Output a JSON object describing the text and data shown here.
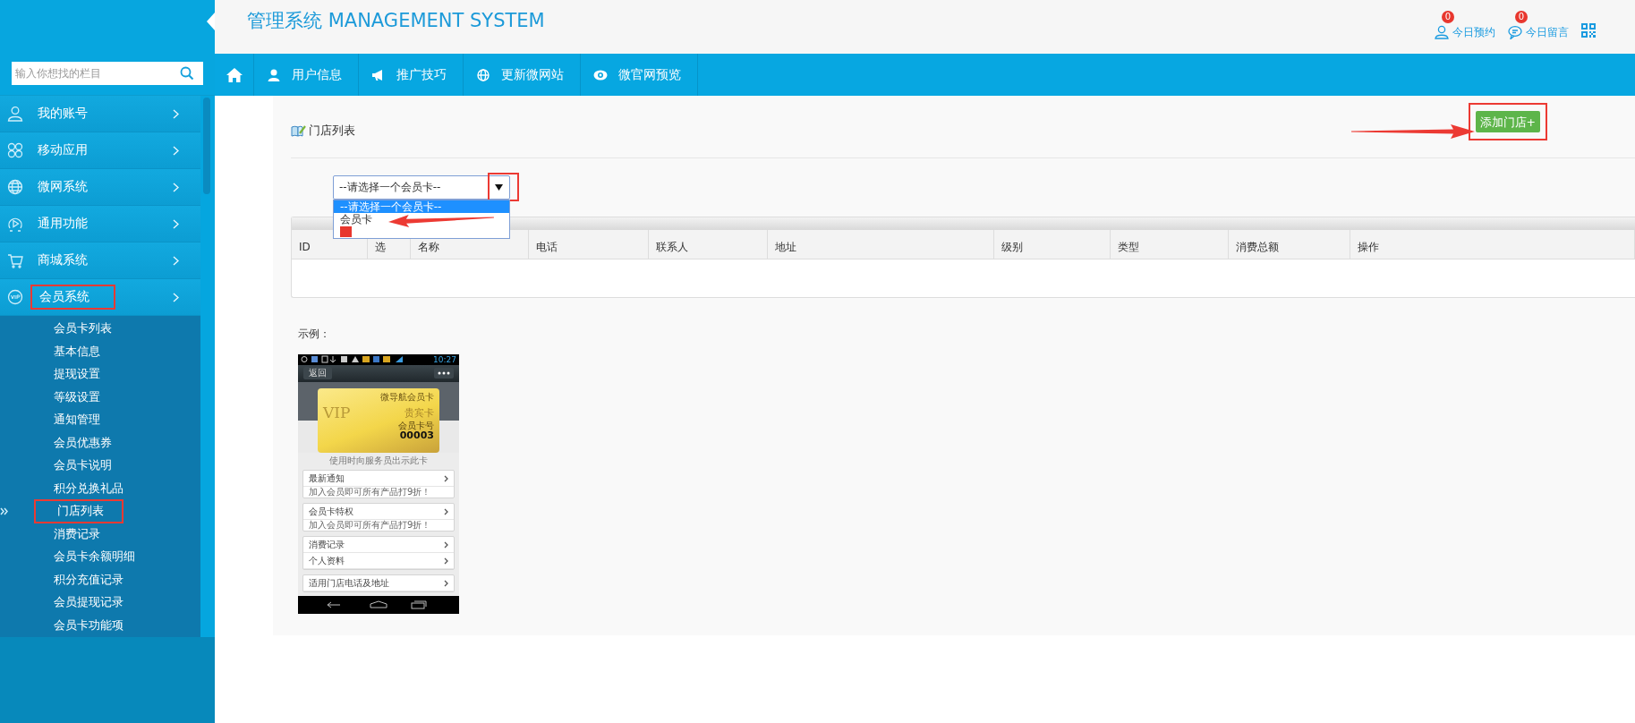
{
  "header": {
    "title": "管理系统 MANAGEMENT SYSTEM",
    "notices": [
      {
        "count": "0",
        "label": "今日预约"
      },
      {
        "count": "0",
        "label": "今日留言"
      }
    ]
  },
  "sidebar": {
    "search": {
      "placeholder": "输入你想找的栏目"
    },
    "items": [
      {
        "label": "我的账号",
        "annotated": false
      },
      {
        "label": "移动应用",
        "annotated": false
      },
      {
        "label": "微网系统",
        "annotated": false
      },
      {
        "label": "通用功能",
        "annotated": false
      },
      {
        "label": "商城系统",
        "annotated": false
      },
      {
        "label": "会员系统",
        "annotated": true,
        "children": [
          {
            "label": "会员卡列表",
            "selected": false
          },
          {
            "label": "基本信息",
            "selected": false
          },
          {
            "label": "提现设置",
            "selected": false
          },
          {
            "label": "等级设置",
            "selected": false
          },
          {
            "label": "通知管理",
            "selected": false
          },
          {
            "label": "会员优惠券",
            "selected": false
          },
          {
            "label": "会员卡说明",
            "selected": false
          },
          {
            "label": "积分兑换礼品",
            "selected": false
          },
          {
            "label": "门店列表",
            "selected": true
          },
          {
            "label": "消费记录",
            "selected": false
          },
          {
            "label": "会员卡余额明细",
            "selected": false
          },
          {
            "label": "积分充值记录",
            "selected": false
          },
          {
            "label": "会员提现记录",
            "selected": false
          },
          {
            "label": "会员卡功能项",
            "selected": false
          }
        ]
      }
    ]
  },
  "nav": {
    "items": [
      {
        "label": "用户信息"
      },
      {
        "label": "推广技巧"
      },
      {
        "label": "更新微网站"
      },
      {
        "label": "微官网预览"
      }
    ]
  },
  "page": {
    "title": "门店列表",
    "add_button": {
      "label": "添加门店+",
      "annotated": true
    },
    "select": {
      "value": "--请选择一个会员卡--",
      "annotated": true,
      "options": [
        {
          "label": "--请选择一个会员卡--",
          "selected": true,
          "redacted": false
        },
        {
          "label": "会员卡",
          "selected": false,
          "redacted": false
        },
        {
          "selected": false,
          "redacted": true
        }
      ]
    },
    "table": {
      "columns": [
        "ID",
        "选",
        "名称",
        "电话",
        "联系人",
        "地址",
        "级别",
        "类型",
        "消费总额",
        "操作"
      ]
    },
    "example": {
      "label": "示例：",
      "phone": {
        "time": "10:27",
        "back": "返回",
        "card": {
          "brand": "微导航会员卡",
          "vip": "VIP",
          "name": "贵宾卡",
          "number_label": "会员卡号",
          "number": "00003"
        },
        "hint": "使用时向服务员出示此卡",
        "groups": [
          [
            {
              "title": "最新通知",
              "note": "加入会员即可所有产品打9折！"
            }
          ],
          [
            {
              "title": "会员卡特权",
              "note": "加入会员即可所有产品打9折！"
            }
          ],
          [
            {
              "title": "消费记录"
            },
            {
              "title": "个人资料"
            }
          ],
          [
            {
              "title": "适用门店电话及地址"
            }
          ]
        ]
      }
    }
  }
}
